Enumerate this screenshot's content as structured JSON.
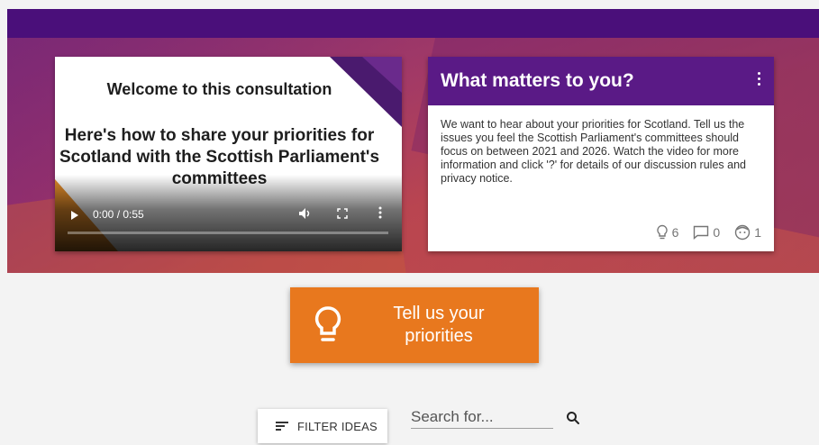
{
  "video": {
    "title": "Welcome to this consultation",
    "subtitle": "Here's how to share your priorities for Scotland with the Scottish Parliament's committees",
    "time": "0:00 / 0:55"
  },
  "card": {
    "title": "What matters to you?",
    "body": "We want to hear about your priorities for Scotland. Tell us the issues you feel the Scottish Parliament's committees should focus on between 2021 and 2026. Watch the video for more information and click '?' for details of our discussion rules and privacy notice.",
    "stats": {
      "ideas": "6",
      "comments": "0",
      "participants": "1"
    }
  },
  "cta": {
    "label": "Tell us your priorities"
  },
  "filter": {
    "label": "FILTER IDEAS"
  },
  "search": {
    "placeholder": "Search for..."
  },
  "colors": {
    "header_purple": "#4a0f7a",
    "card_header": "#5a1a86",
    "cta_orange": "#e8781e"
  }
}
